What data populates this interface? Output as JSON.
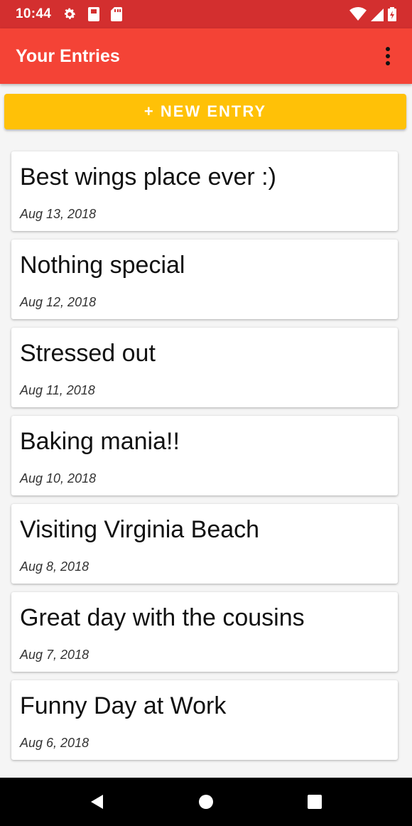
{
  "status_bar": {
    "time": "10:44",
    "icons": [
      "gear-icon",
      "sd-card-icon",
      "sim-card-icon",
      "wifi-icon",
      "cell-signal-icon",
      "battery-charging-icon"
    ]
  },
  "app_bar": {
    "title": "Your Entries",
    "menu_icon": "more-vertical-icon"
  },
  "new_entry_button": {
    "label": "+ NEW ENTRY"
  },
  "entries": [
    {
      "title": "Best wings place ever :)",
      "date": "Aug 13, 2018"
    },
    {
      "title": "Nothing special",
      "date": "Aug 12, 2018"
    },
    {
      "title": "Stressed out",
      "date": "Aug 11, 2018"
    },
    {
      "title": "Baking mania!!",
      "date": "Aug 10, 2018"
    },
    {
      "title": "Visiting Virginia Beach",
      "date": "Aug 8, 2018"
    },
    {
      "title": "Great day with the cousins",
      "date": "Aug 7, 2018"
    },
    {
      "title": "Funny Day at Work",
      "date": "Aug 6, 2018"
    }
  ],
  "nav_bar": {
    "icons": [
      "back-icon",
      "home-icon",
      "recents-icon"
    ]
  },
  "colors": {
    "status_bar": "#d32f2f",
    "app_bar": "#f44336",
    "accent_button": "#ffc107",
    "background": "#f5f5f5"
  }
}
